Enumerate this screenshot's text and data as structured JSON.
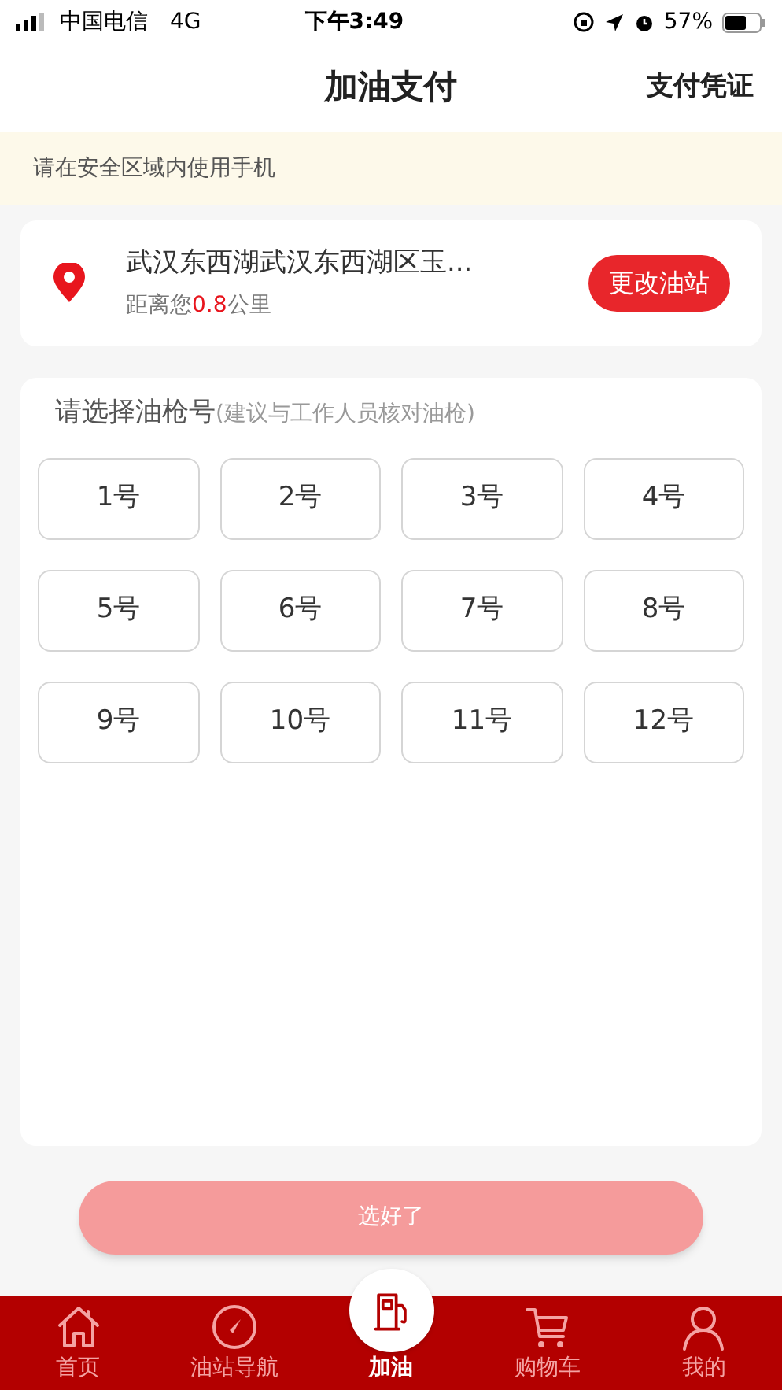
{
  "status_bar": {
    "carrier": "中国电信",
    "network": "4G",
    "time": "下午3:49",
    "battery": "57%"
  },
  "nav": {
    "title": "加油支付",
    "action": "支付凭证"
  },
  "notice": "请在安全区域内使用手机",
  "station": {
    "name": "武汉东西湖武汉东西湖区玉...",
    "distance": "距离您**0.8**公里",
    "change_button": "更改油站"
  },
  "nozzles": {
    "title": "请选择油枪号",
    "hint": "(建议与工作人员核对油枪)",
    "items": [
      {
        "label": "1号",
        "selected": false
      },
      {
        "label": "2号",
        "selected": false
      },
      {
        "label": "3号",
        "selected": false
      },
      {
        "label": "4号",
        "selected": false
      },
      {
        "label": "5号",
        "selected": false
      },
      {
        "label": "6号",
        "selected": false
      },
      {
        "label": "7号",
        "selected": false
      },
      {
        "label": "8号",
        "selected": false
      },
      {
        "label": "9号",
        "selected": false
      },
      {
        "label": "10号",
        "selected": false
      },
      {
        "label": "11号",
        "selected": false
      },
      {
        "label": "12号",
        "selected": false
      }
    ]
  },
  "confirm_button": {
    "label": "选好了",
    "disabled": true
  },
  "tab_bar": [
    {
      "kind": "home",
      "label": "首页",
      "selected": false
    },
    {
      "kind": "compass",
      "label": "油站导航",
      "selected": false
    },
    {
      "kind": "fuel",
      "label": "加油",
      "selected": true
    },
    {
      "kind": "cart",
      "label": "购物车",
      "selected": false
    },
    {
      "kind": "user",
      "label": "我的",
      "selected": false
    }
  ]
}
